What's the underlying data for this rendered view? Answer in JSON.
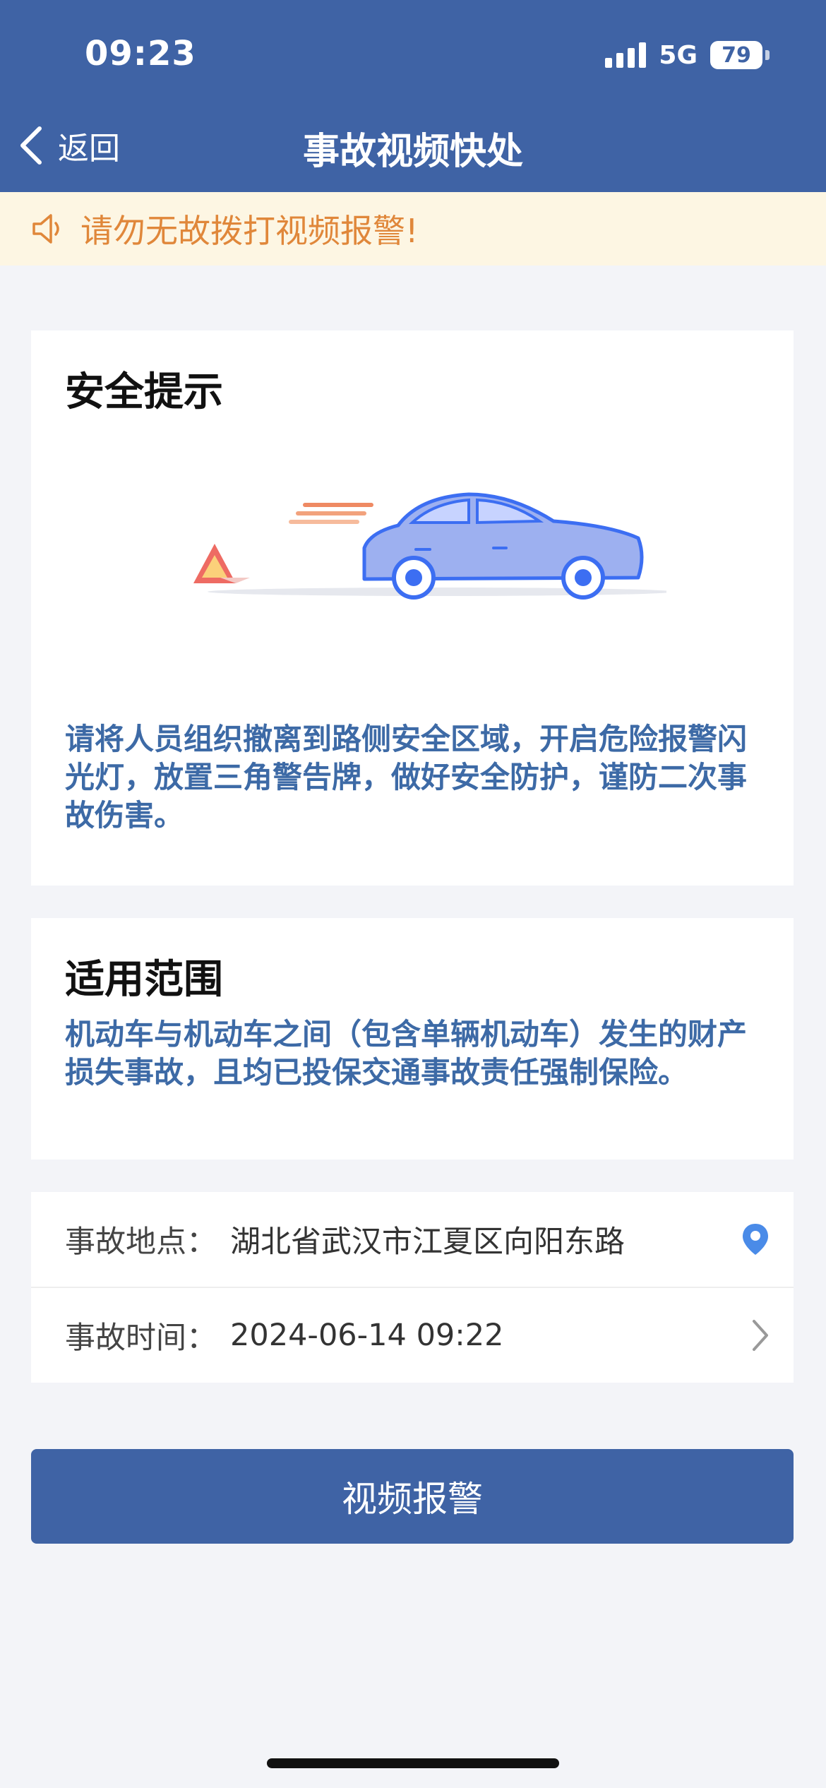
{
  "status_bar": {
    "time": "09:23",
    "network": "5G",
    "battery": "79"
  },
  "nav": {
    "back_label": "返回",
    "title": "事故视频快处"
  },
  "notice": {
    "text": "请勿无故拨打视频报警!",
    "icon": "speaker-icon"
  },
  "safety_card": {
    "title": "安全提示",
    "body": "请将人员组织撤离到路侧安全区域，开启危险报警闪光灯，放置三角警告牌，做好安全防护，谨防二次事故伤害。"
  },
  "scope_card": {
    "title": "适用范围",
    "body": "机动车与机动车之间（包含单辆机动车）发生的财产损失事故，且均已投保交通事故责任强制保险。"
  },
  "accident_info": {
    "location_label": "事故地点：",
    "location_value": "湖北省武汉市江夏区向阳东路",
    "time_label": "事故时间：",
    "time_value": "2024-06-14 09:22"
  },
  "actions": {
    "video_report": "视频报警"
  },
  "colors": {
    "primary": "#3f63a5",
    "notice_bg": "#fdf6e3",
    "notice_text": "#e0873a",
    "body_blue": "#3d6aa6",
    "location_pin": "#4a8be8"
  }
}
